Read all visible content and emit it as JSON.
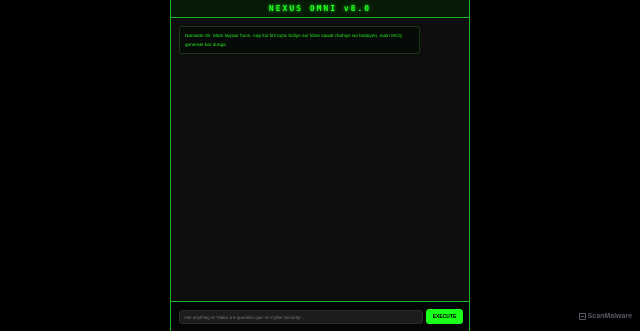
{
  "header": {
    "title": "NEXUS OMNI v8.0"
  },
  "chat": {
    "messages": [
      {
        "role": "bot",
        "text": "Namaste Sir. Main taiyaar hoon. Aap koi bhi topic boliye aur kitne sawal chahiye wo bataiyen, main MCQ generate kar dunga."
      }
    ]
  },
  "input": {
    "placeholder": "Ask anything or 'Make a 5 question quiz on Cyber Security'...",
    "value": ""
  },
  "actions": {
    "execute_label": "EXECUTE"
  },
  "watermark": {
    "text": "ScanMalware",
    "icon": "scanmalware-logo-icon"
  },
  "colors": {
    "accent": "#1aff1a",
    "border": "#1fb01f",
    "background": "#000000",
    "panel": "#0e0e0e"
  }
}
